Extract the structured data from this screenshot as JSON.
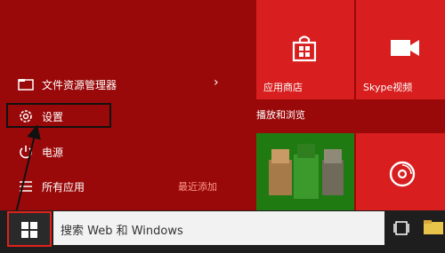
{
  "start_menu": {
    "items": [
      {
        "label": "文件资源管理器",
        "icon": "folder-icon",
        "chevron": "›"
      },
      {
        "label": "设置",
        "icon": "gear-icon"
      },
      {
        "label": "电源",
        "icon": "power-icon"
      },
      {
        "label": "所有应用",
        "icon": "list-icon",
        "badge": "最近添加"
      }
    ],
    "group_label": "播放和浏览",
    "tiles": [
      {
        "label": "应用商店",
        "icon": "store-icon"
      },
      {
        "label": "Skype视频",
        "icon": "video-camera-icon"
      },
      {
        "label": "",
        "icon": "game-characters-image"
      },
      {
        "label": "",
        "icon": "music-disc-icon"
      }
    ]
  },
  "taskbar": {
    "search_text": "搜索 Web 和 Windows",
    "start_icon": "windows-logo-icon",
    "taskview_icon": "task-view-icon"
  },
  "colors": {
    "menu_background": "#9a0909",
    "tile_red": "#d81e1e",
    "tile_green": "#1f7a12",
    "annotation_arrow": "#e0211b"
  }
}
